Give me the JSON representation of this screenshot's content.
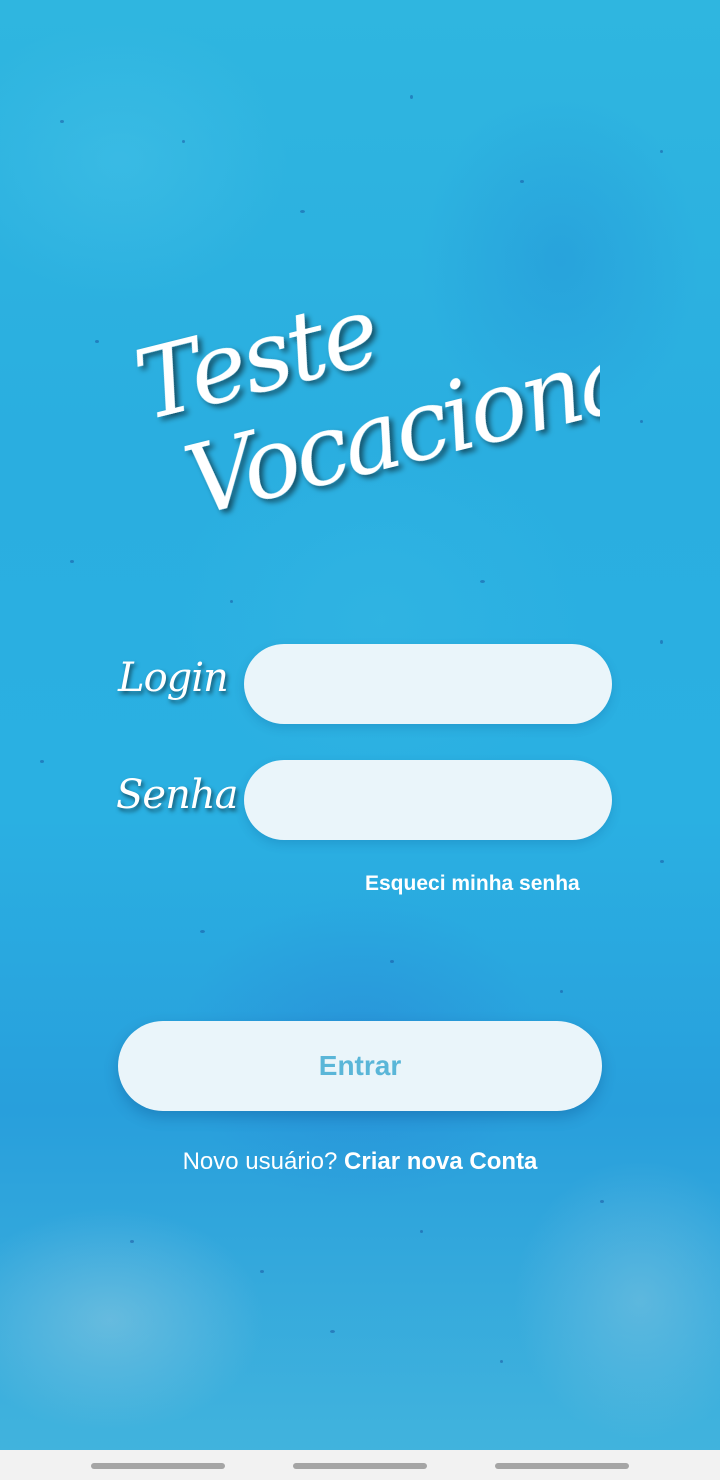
{
  "app": {
    "title_line1": "Teste",
    "title_line2": "Vocacional"
  },
  "form": {
    "login_label": "Login",
    "login_value": "",
    "password_label": "Senha",
    "password_value": "",
    "forgot_password": "Esqueci minha senha",
    "submit_label": "Entrar"
  },
  "signup": {
    "prompt": "Novo usuário?",
    "link": "Criar nova Conta"
  },
  "colors": {
    "background": "#2ab0e2",
    "input_bg": "#eaf5fa",
    "button_text": "#5ab6d8"
  },
  "navbar": {
    "icons": [
      "nav-handle",
      "nav-handle",
      "nav-handle"
    ]
  }
}
